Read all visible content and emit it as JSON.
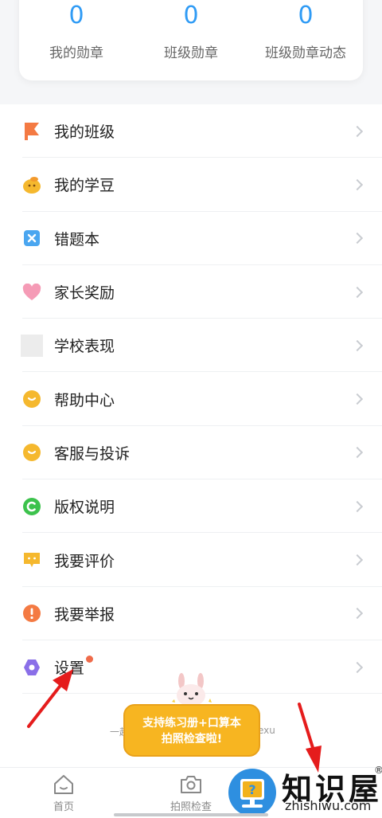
{
  "stats": [
    {
      "value": "0",
      "label": "我的勋章"
    },
    {
      "value": "0",
      "label": "班级勋章"
    },
    {
      "value": "0",
      "label": "班级勋章动态"
    }
  ],
  "menu": [
    {
      "label": "我的班级",
      "icon": "flag-icon",
      "color": "#f47a43"
    },
    {
      "label": "我的学豆",
      "icon": "bean-icon",
      "color": "#f5b82e"
    },
    {
      "label": "错题本",
      "icon": "wrong-book-icon",
      "color": "#4aa6f0"
    },
    {
      "label": "家长奖励",
      "icon": "heart-icon",
      "color": "#f27ba0"
    },
    {
      "label": "学校表现",
      "icon": "school-icon",
      "color": "#e8e8e8"
    },
    {
      "label": "帮助中心",
      "icon": "help-icon",
      "color": "#f5b82e"
    },
    {
      "label": "客服与投诉",
      "icon": "service-icon",
      "color": "#f5b82e"
    },
    {
      "label": "版权说明",
      "icon": "copyright-icon",
      "color": "#3cc24c"
    },
    {
      "label": "我要评价",
      "icon": "rate-icon",
      "color": "#f5b82e"
    },
    {
      "label": "我要举报",
      "icon": "report-icon",
      "color": "#f47a43"
    },
    {
      "label": "设置",
      "icon": "settings-icon",
      "color": "#8a6fe8"
    }
  ],
  "footer": {
    "left": "一起",
    "right": "exu"
  },
  "promo": {
    "line1": "支持练习册+口算本",
    "line2": "拍照检查啦!"
  },
  "tabs": [
    {
      "label": "首页",
      "icon": "home-icon"
    },
    {
      "label": "拍照检查",
      "icon": "camera-icon"
    }
  ],
  "watermark": {
    "title": "知识屋",
    "sub": "zhishiwu.com",
    "reg": "®"
  }
}
